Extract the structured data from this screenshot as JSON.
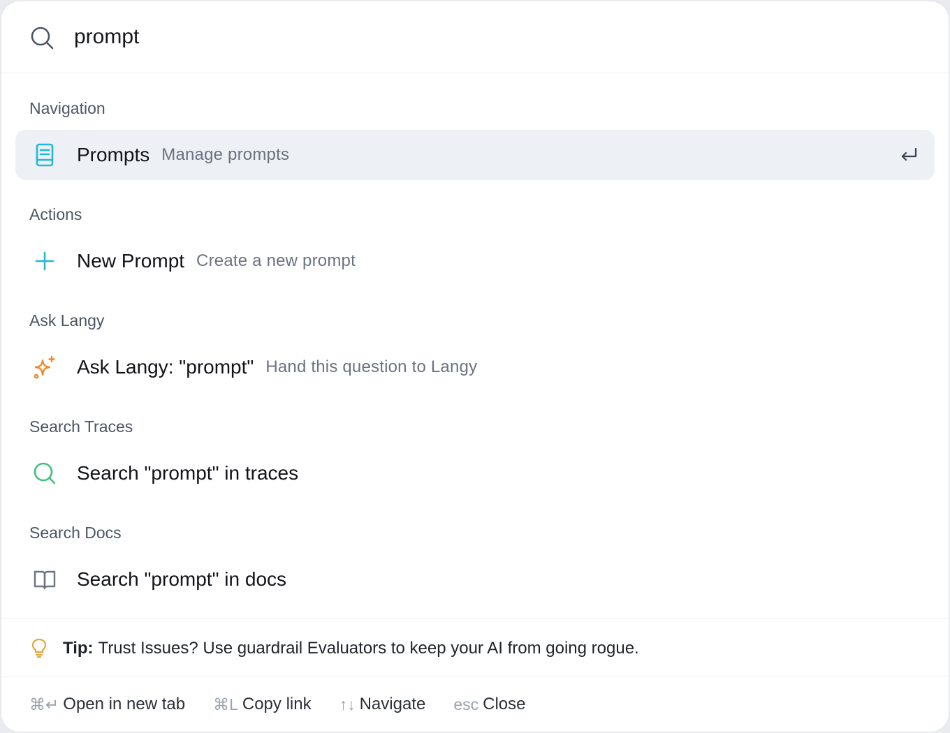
{
  "search": {
    "value": "prompt",
    "icon": "search-icon"
  },
  "groups": {
    "navigation": {
      "title": "Navigation",
      "item": {
        "label": "Prompts",
        "description": "Manage prompts",
        "icon": "document-icon",
        "selected": true
      }
    },
    "actions": {
      "title": "Actions",
      "item": {
        "label": "New Prompt",
        "description": "Create a new prompt",
        "icon": "plus-icon"
      }
    },
    "ask_langy": {
      "title": "Ask Langy",
      "item": {
        "label": "Ask Langy: \"prompt\"",
        "description": "Hand this question to Langy",
        "icon": "sparkle-icon"
      }
    },
    "search_traces": {
      "title": "Search Traces",
      "item": {
        "label": "Search \"prompt\" in traces",
        "icon": "search-icon"
      }
    },
    "search_docs": {
      "title": "Search Docs",
      "item": {
        "label": "Search \"prompt\" in docs",
        "icon": "book-icon"
      }
    }
  },
  "tip": {
    "prefix": "Tip:",
    "text": "Trust Issues? Use guardrail Evaluators to keep your AI from going rogue.",
    "icon": "lightbulb-icon"
  },
  "footer": {
    "hints": [
      {
        "key": "⌘↵",
        "label": "Open in new tab"
      },
      {
        "key": "⌘L",
        "label": "Copy link"
      },
      {
        "key": "↑↓",
        "label": "Navigate"
      },
      {
        "key": "esc",
        "label": "Close"
      }
    ]
  },
  "colors": {
    "selected_bg": "#edf0f4",
    "document_icon": "#22b8d6",
    "plus_icon": "#22b8d6",
    "sparkle_icon": "#ef8a2c",
    "traces_icon": "#3fbf7f",
    "tip_icon": "#e8a53a"
  }
}
